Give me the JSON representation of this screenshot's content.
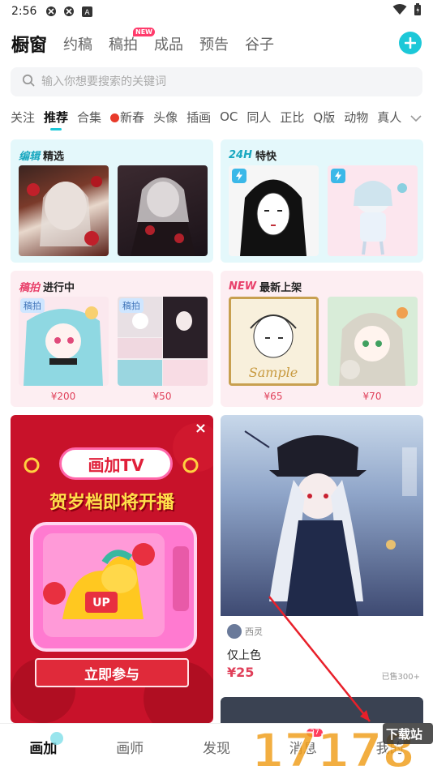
{
  "status_bar": {
    "time": "2:56"
  },
  "top_nav": {
    "tabs": [
      {
        "label": "橱窗",
        "active": true
      },
      {
        "label": "约稿",
        "active": false
      },
      {
        "label": "稿拍",
        "active": false,
        "badge": "NEW"
      },
      {
        "label": "成品",
        "active": false
      },
      {
        "label": "预告",
        "active": false
      },
      {
        "label": "谷子",
        "active": false
      }
    ]
  },
  "search": {
    "placeholder": "输入你想要搜索的关键词"
  },
  "categories": [
    "关注",
    "推荐",
    "合集",
    "新春",
    "头像",
    "插画",
    "OC",
    "同人",
    "正比",
    "Q版",
    "动物",
    "真人"
  ],
  "active_category": "推荐",
  "features": {
    "editor_pick": {
      "tag": "编辑",
      "title": "精选"
    },
    "h24": {
      "tag": "24H",
      "title": "特快"
    },
    "auction": {
      "tag": "稿拍",
      "title": "进行中",
      "items": [
        {
          "label": "稿拍",
          "price": "¥200"
        },
        {
          "label": "稿拍",
          "price": "¥50"
        }
      ]
    },
    "new_arrival": {
      "tag": "NEW",
      "title": "最新上架",
      "items": [
        {
          "price": "¥65"
        },
        {
          "price": "¥70"
        }
      ]
    }
  },
  "ad": {
    "line1": "画加TV",
    "line2": "贺岁档即将开播",
    "cta": "立即参与",
    "close": "×"
  },
  "product": {
    "seller": "西灵",
    "name": "仅上色",
    "price": "¥25",
    "sold": "已售300+"
  },
  "bottom_nav": [
    {
      "label": "画加",
      "active": true
    },
    {
      "label": "画师",
      "active": false
    },
    {
      "label": "发现",
      "active": false
    },
    {
      "label": "消息",
      "active": false,
      "count": "27"
    },
    {
      "label": "我的",
      "active": false
    }
  ],
  "watermark": {
    "text": "17178",
    "tag": "下载站"
  },
  "colors": {
    "accent": "#1cc8d8",
    "price": "#e0405a",
    "ad_red": "#c8122a"
  }
}
